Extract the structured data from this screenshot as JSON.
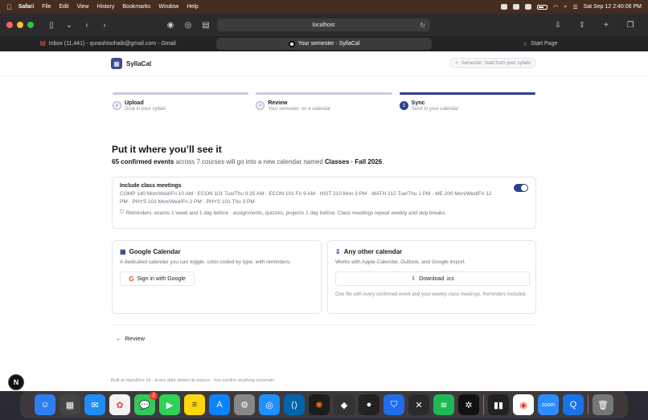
{
  "menubar": {
    "app": "Safari",
    "items": [
      "File",
      "Edit",
      "View",
      "History",
      "Bookmarks",
      "Window",
      "Help"
    ],
    "clock": "Sat Sep 12  2:40:06 PM"
  },
  "browser": {
    "address": "localhost",
    "tabs": [
      {
        "label": "Inbox (11,441) - qurashisohaib@gmail.com - Gmail"
      },
      {
        "label": "Your semester · SyllaCal"
      },
      {
        "label": "Start Page"
      }
    ]
  },
  "app": {
    "brand": "SyllaCal",
    "semester_pill": "Semester: read from your syllabi"
  },
  "steps": [
    {
      "title": "Upload",
      "sub": "Drop in your syllabi",
      "marker": "✓"
    },
    {
      "title": "Review",
      "sub": "Your semester, on a calendar",
      "marker": "✓"
    },
    {
      "title": "Sync",
      "sub": "Send to your calendar",
      "marker": "3"
    }
  ],
  "main": {
    "headline": "Put it where you’ll see it",
    "summary_count": "65 confirmed events",
    "summary_middle": " across 7 courses will go into a new calendar named ",
    "summary_calendar": "Classes · Fall 2026",
    "summary_end": "."
  },
  "meetings": {
    "title": "Include class meetings",
    "list": "COMP 140 Mon/Wed/Fri 10 AM · ECON 101 Tue/Thu 9:25 AM · ECON 101 Fri 9 AM · HIST 210 Mon 3 PM · MATH 212 Tue/Thu 1 PM · ME 200 Mon/Wed/Fri 12 PM · PHYS 101 Mon/Wed/Fri 2 PM · PHYS 101 Thu 3 PM",
    "reminders": "Reminders: exams 1 week and 1 day before · assignments, quizzes, projects 1 day before. Class meetings repeat weekly and skip breaks.",
    "toggle_on": true
  },
  "google": {
    "title": "Google Calendar",
    "desc": "A dedicated calendar you can toggle, color-coded by type, with reminders.",
    "button": "Sign in with Google"
  },
  "ics": {
    "title": "Any other calendar",
    "desc": "Works with Apple Calendar, Outlook, and Google import.",
    "button": "Download .ics",
    "note": "One file with every confirmed event and your weekly class meetings. Reminders included."
  },
  "nav": {
    "back": "Review"
  },
  "footer": "Built at HackRice 16 · Every date shows its source · You confirm anything uncertain",
  "dock": {
    "badge_messages": "2"
  }
}
